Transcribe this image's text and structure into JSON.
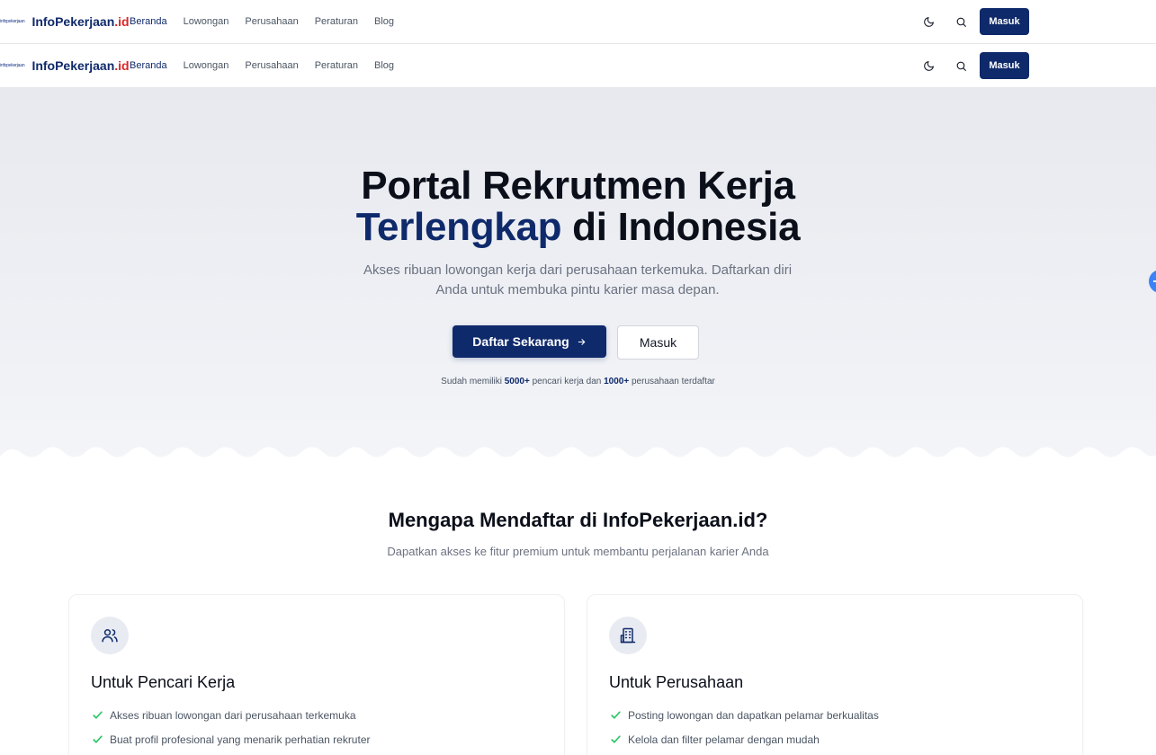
{
  "brand": {
    "logo_mark": "infopekerjaan",
    "name_main": "InfoPekerjaan",
    "name_suffix": ".id"
  },
  "nav": {
    "links": [
      "Beranda",
      "Lowongan",
      "Perusahaan",
      "Peraturan",
      "Blog"
    ],
    "active": "Beranda",
    "login_label": "Masuk",
    "icons": [
      "moon-icon",
      "search-icon"
    ]
  },
  "hero": {
    "title_line1": "Portal Rekrutmen Kerja",
    "title_highlight": "Terlengkap",
    "title_line2_rest": " di Indonesia",
    "subtitle_line1": "Akses ribuan lowongan kerja dari perusahaan terkemuka. Daftarkan diri",
    "subtitle_line2": "Anda untuk membuka pintu karier masa depan.",
    "cta_primary": "Daftar Sekarang",
    "cta_secondary": "Masuk",
    "stats_prefix": "Sudah memiliki ",
    "stats_seekers": "5000+",
    "stats_middle": " pencari kerja dan ",
    "stats_companies": "1000+",
    "stats_suffix": " perusahaan terdaftar"
  },
  "features": {
    "title": "Mengapa Mendaftar di InfoPekerjaan.id?",
    "subtitle": "Dapatkan akses ke fitur premium untuk membantu perjalanan karier Anda",
    "cards": [
      {
        "icon": "users-icon",
        "title": "Untuk Pencari Kerja",
        "items": [
          "Akses ribuan lowongan dari perusahaan terkemuka",
          "Buat profil profesional yang menarik perhatian rekruter"
        ]
      },
      {
        "icon": "building-icon",
        "title": "Untuk Perusahaan",
        "items": [
          "Posting lowongan dan dapatkan pelamar berkualitas",
          "Kelola dan filter pelamar dengan mudah"
        ]
      }
    ]
  },
  "colors": {
    "primary": "#0f2a6b",
    "accent": "#dc2626",
    "check": "#22c55e"
  }
}
